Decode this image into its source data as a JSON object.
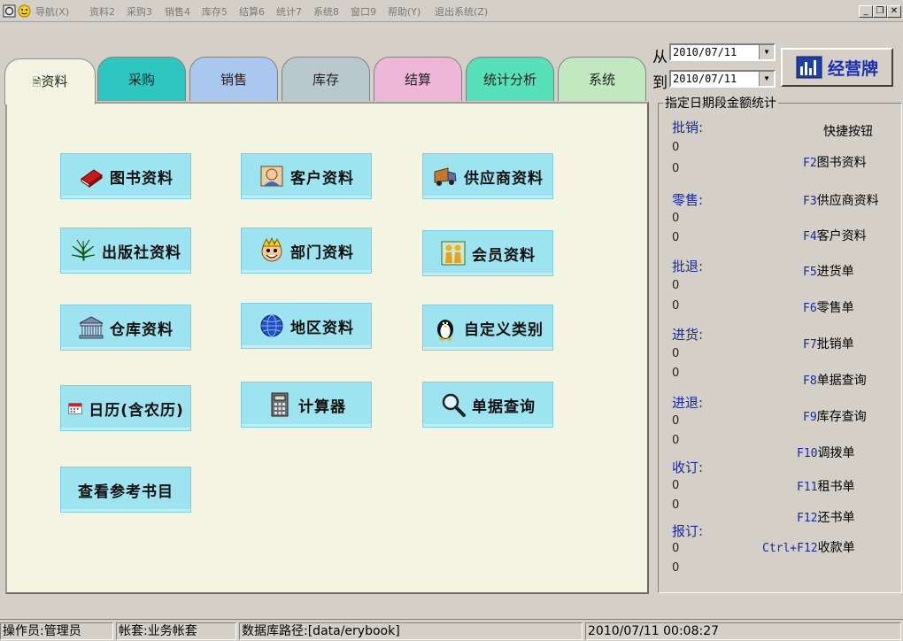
{
  "menu": [
    "导航(X)",
    "资料2",
    "采购3",
    "销售4",
    "库存5",
    "结算6",
    "统计7",
    "系统8",
    "窗口9",
    "帮助(Y)",
    "退出系统(Z)"
  ],
  "tabs": [
    {
      "label": "资料",
      "color": "#f3f5e2"
    },
    {
      "label": "采购",
      "color": "#2ec7c0"
    },
    {
      "label": "销售",
      "color": "#aac8ee"
    },
    {
      "label": "库存",
      "color": "#b9c8cc"
    },
    {
      "label": "结算",
      "color": "#eeb7d8"
    },
    {
      "label": "统计分析",
      "color": "#58e0b8"
    },
    {
      "label": "系统",
      "color": "#c2e8c0"
    }
  ],
  "functions": [
    {
      "label": "图书资料",
      "icon": "book-icon"
    },
    {
      "label": "客户资料",
      "icon": "customer-icon"
    },
    {
      "label": "供应商资料",
      "icon": "truck-icon"
    },
    {
      "label": "出版社资料",
      "icon": "leaf-icon"
    },
    {
      "label": "部门资料",
      "icon": "face-icon"
    },
    {
      "label": "会员资料",
      "icon": "members-icon"
    },
    {
      "label": "仓库资料",
      "icon": "warehouse-icon"
    },
    {
      "label": "地区资料",
      "icon": "globe-icon"
    },
    {
      "label": "自定义类别",
      "icon": "penguin-icon"
    },
    {
      "label": "日历(含农历)",
      "icon": "calendar-icon"
    },
    {
      "label": "计算器",
      "icon": "calculator-icon"
    },
    {
      "label": "单据查询",
      "icon": "magnifier-icon"
    },
    {
      "label": "查看参考书目",
      "icon": ""
    }
  ],
  "date_range": {
    "from_label": "从",
    "to_label": "到",
    "from": "2010/07/11",
    "to": "2010/07/11"
  },
  "report_button": "经营牌",
  "stats": {
    "title": "指定日期段金额统计",
    "shortcut_title": "快捷按钮",
    "groups": [
      {
        "label": "批销:",
        "values": [
          "0",
          "0"
        ]
      },
      {
        "label": "零售:",
        "values": [
          "0",
          "0"
        ]
      },
      {
        "label": "批退:",
        "values": [
          "0",
          "0"
        ]
      },
      {
        "label": "进货:",
        "values": [
          "0",
          "0"
        ]
      },
      {
        "label": "进退:",
        "values": [
          "0",
          "0"
        ]
      },
      {
        "label": "收订:",
        "values": [
          "0",
          "0"
        ]
      },
      {
        "label": "报订:",
        "values": [
          "0",
          "0"
        ]
      }
    ],
    "shortcuts": [
      {
        "key": "F2",
        "label": "图书资料"
      },
      {
        "key": "F3",
        "label": "供应商资料"
      },
      {
        "key": "F4",
        "label": "客户资料"
      },
      {
        "key": "F5",
        "label": "进货单"
      },
      {
        "key": "F6",
        "label": "零售单"
      },
      {
        "key": "F7",
        "label": "批销单"
      },
      {
        "key": "F8",
        "label": "单据查询"
      },
      {
        "key": "F9",
        "label": "库存查询"
      },
      {
        "key": "F10",
        "label": "调拨单"
      },
      {
        "key": "F11",
        "label": "租书单"
      },
      {
        "key": "F12",
        "label": "还书单"
      },
      {
        "key": "Ctrl+F12",
        "label": "收款单"
      }
    ]
  },
  "status": {
    "operator": "操作员:管理员",
    "account": "帐套:业务帐套",
    "db_path": "数据库路径:[data/erybook]",
    "datetime": "2010/07/11 00:08:27"
  }
}
